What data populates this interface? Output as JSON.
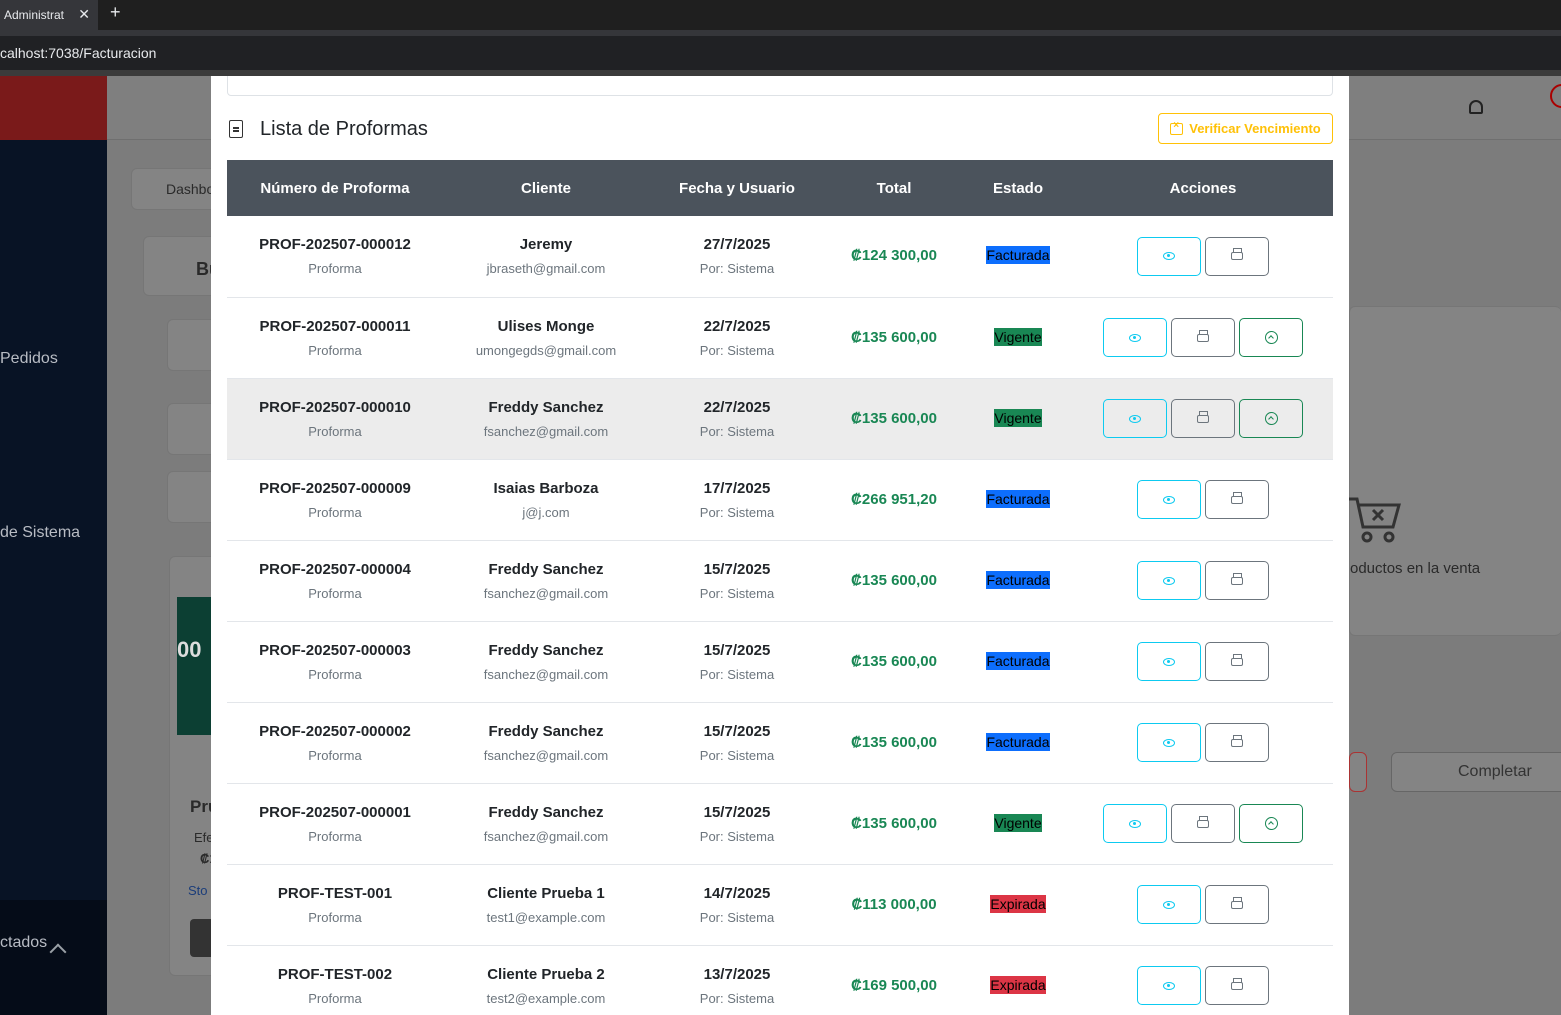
{
  "browser": {
    "tab_title": "Administrat",
    "tab_close": "✕",
    "new_tab": "+",
    "url_host": "calhost:7038",
    "url_path": "/Facturacion"
  },
  "background": {
    "sidebar_items": [
      "Pedidos",
      "de Sistema",
      "ctados"
    ],
    "breadcrumb": "Dashbo",
    "search_title_fragment": "Bu",
    "empty_cart_text": "oductos en la venta",
    "complete_button": "Completar",
    "product_name_fragment": "Pru",
    "product_meta_fragment": "Efe",
    "product_price_fragment": "₡1",
    "product_stock_fragment": "Sto",
    "product_image_number": "00"
  },
  "modal": {
    "title": "Lista de Proformas",
    "verify_button": "Verificar Vencimiento",
    "columns": [
      "Número de Proforma",
      "Cliente",
      "Fecha y Usuario",
      "Total",
      "Estado",
      "Acciones"
    ],
    "rows": [
      {
        "numero": "PROF-202507-000012",
        "tipo": "Proforma",
        "cliente": "Jeremy",
        "email": "jbraseth@gmail.com",
        "fecha": "27/7/2025",
        "usuario": "Por: Sistema",
        "total": "₡124 300,00",
        "estado": "Facturada"
      },
      {
        "numero": "PROF-202507-000011",
        "tipo": "Proforma",
        "cliente": "Ulises Monge",
        "email": "umongegds@gmail.com",
        "fecha": "22/7/2025",
        "usuario": "Por: Sistema",
        "total": "₡135 600,00",
        "estado": "Vigente"
      },
      {
        "numero": "PROF-202507-000010",
        "tipo": "Proforma",
        "cliente": "Freddy Sanchez",
        "email": "fsanchez@gmail.com",
        "fecha": "22/7/2025",
        "usuario": "Por: Sistema",
        "total": "₡135 600,00",
        "estado": "Vigente"
      },
      {
        "numero": "PROF-202507-000009",
        "tipo": "Proforma",
        "cliente": "Isaias Barboza",
        "email": "j@j.com",
        "fecha": "17/7/2025",
        "usuario": "Por: Sistema",
        "total": "₡266 951,20",
        "estado": "Facturada"
      },
      {
        "numero": "PROF-202507-000004",
        "tipo": "Proforma",
        "cliente": "Freddy Sanchez",
        "email": "fsanchez@gmail.com",
        "fecha": "15/7/2025",
        "usuario": "Por: Sistema",
        "total": "₡135 600,00",
        "estado": "Facturada"
      },
      {
        "numero": "PROF-202507-000003",
        "tipo": "Proforma",
        "cliente": "Freddy Sanchez",
        "email": "fsanchez@gmail.com",
        "fecha": "15/7/2025",
        "usuario": "Por: Sistema",
        "total": "₡135 600,00",
        "estado": "Facturada"
      },
      {
        "numero": "PROF-202507-000002",
        "tipo": "Proforma",
        "cliente": "Freddy Sanchez",
        "email": "fsanchez@gmail.com",
        "fecha": "15/7/2025",
        "usuario": "Por: Sistema",
        "total": "₡135 600,00",
        "estado": "Facturada"
      },
      {
        "numero": "PROF-202507-000001",
        "tipo": "Proforma",
        "cliente": "Freddy Sanchez",
        "email": "fsanchez@gmail.com",
        "fecha": "15/7/2025",
        "usuario": "Por: Sistema",
        "total": "₡135 600,00",
        "estado": "Vigente"
      },
      {
        "numero": "PROF-TEST-001",
        "tipo": "Proforma",
        "cliente": "Cliente Prueba 1",
        "email": "test1@example.com",
        "fecha": "14/7/2025",
        "usuario": "Por: Sistema",
        "total": "₡113 000,00",
        "estado": "Expirada"
      },
      {
        "numero": "PROF-TEST-002",
        "tipo": "Proforma",
        "cliente": "Cliente Prueba 2",
        "email": "test2@example.com",
        "fecha": "13/7/2025",
        "usuario": "Por: Sistema",
        "total": "₡169 500,00",
        "estado": "Expirada"
      }
    ],
    "highlighted_row": 2
  },
  "colors": {
    "header": "#4b535c",
    "facturada": "#0d6efd",
    "vigente": "#198754",
    "expirada": "#dc3545",
    "total": "#198754",
    "warning": "#ffc107"
  },
  "icons": {
    "view": "eye-icon",
    "print": "printer-icon",
    "convert": "arrow-up-circle-icon",
    "title": "document-icon",
    "verify": "calendar-x-icon"
  }
}
